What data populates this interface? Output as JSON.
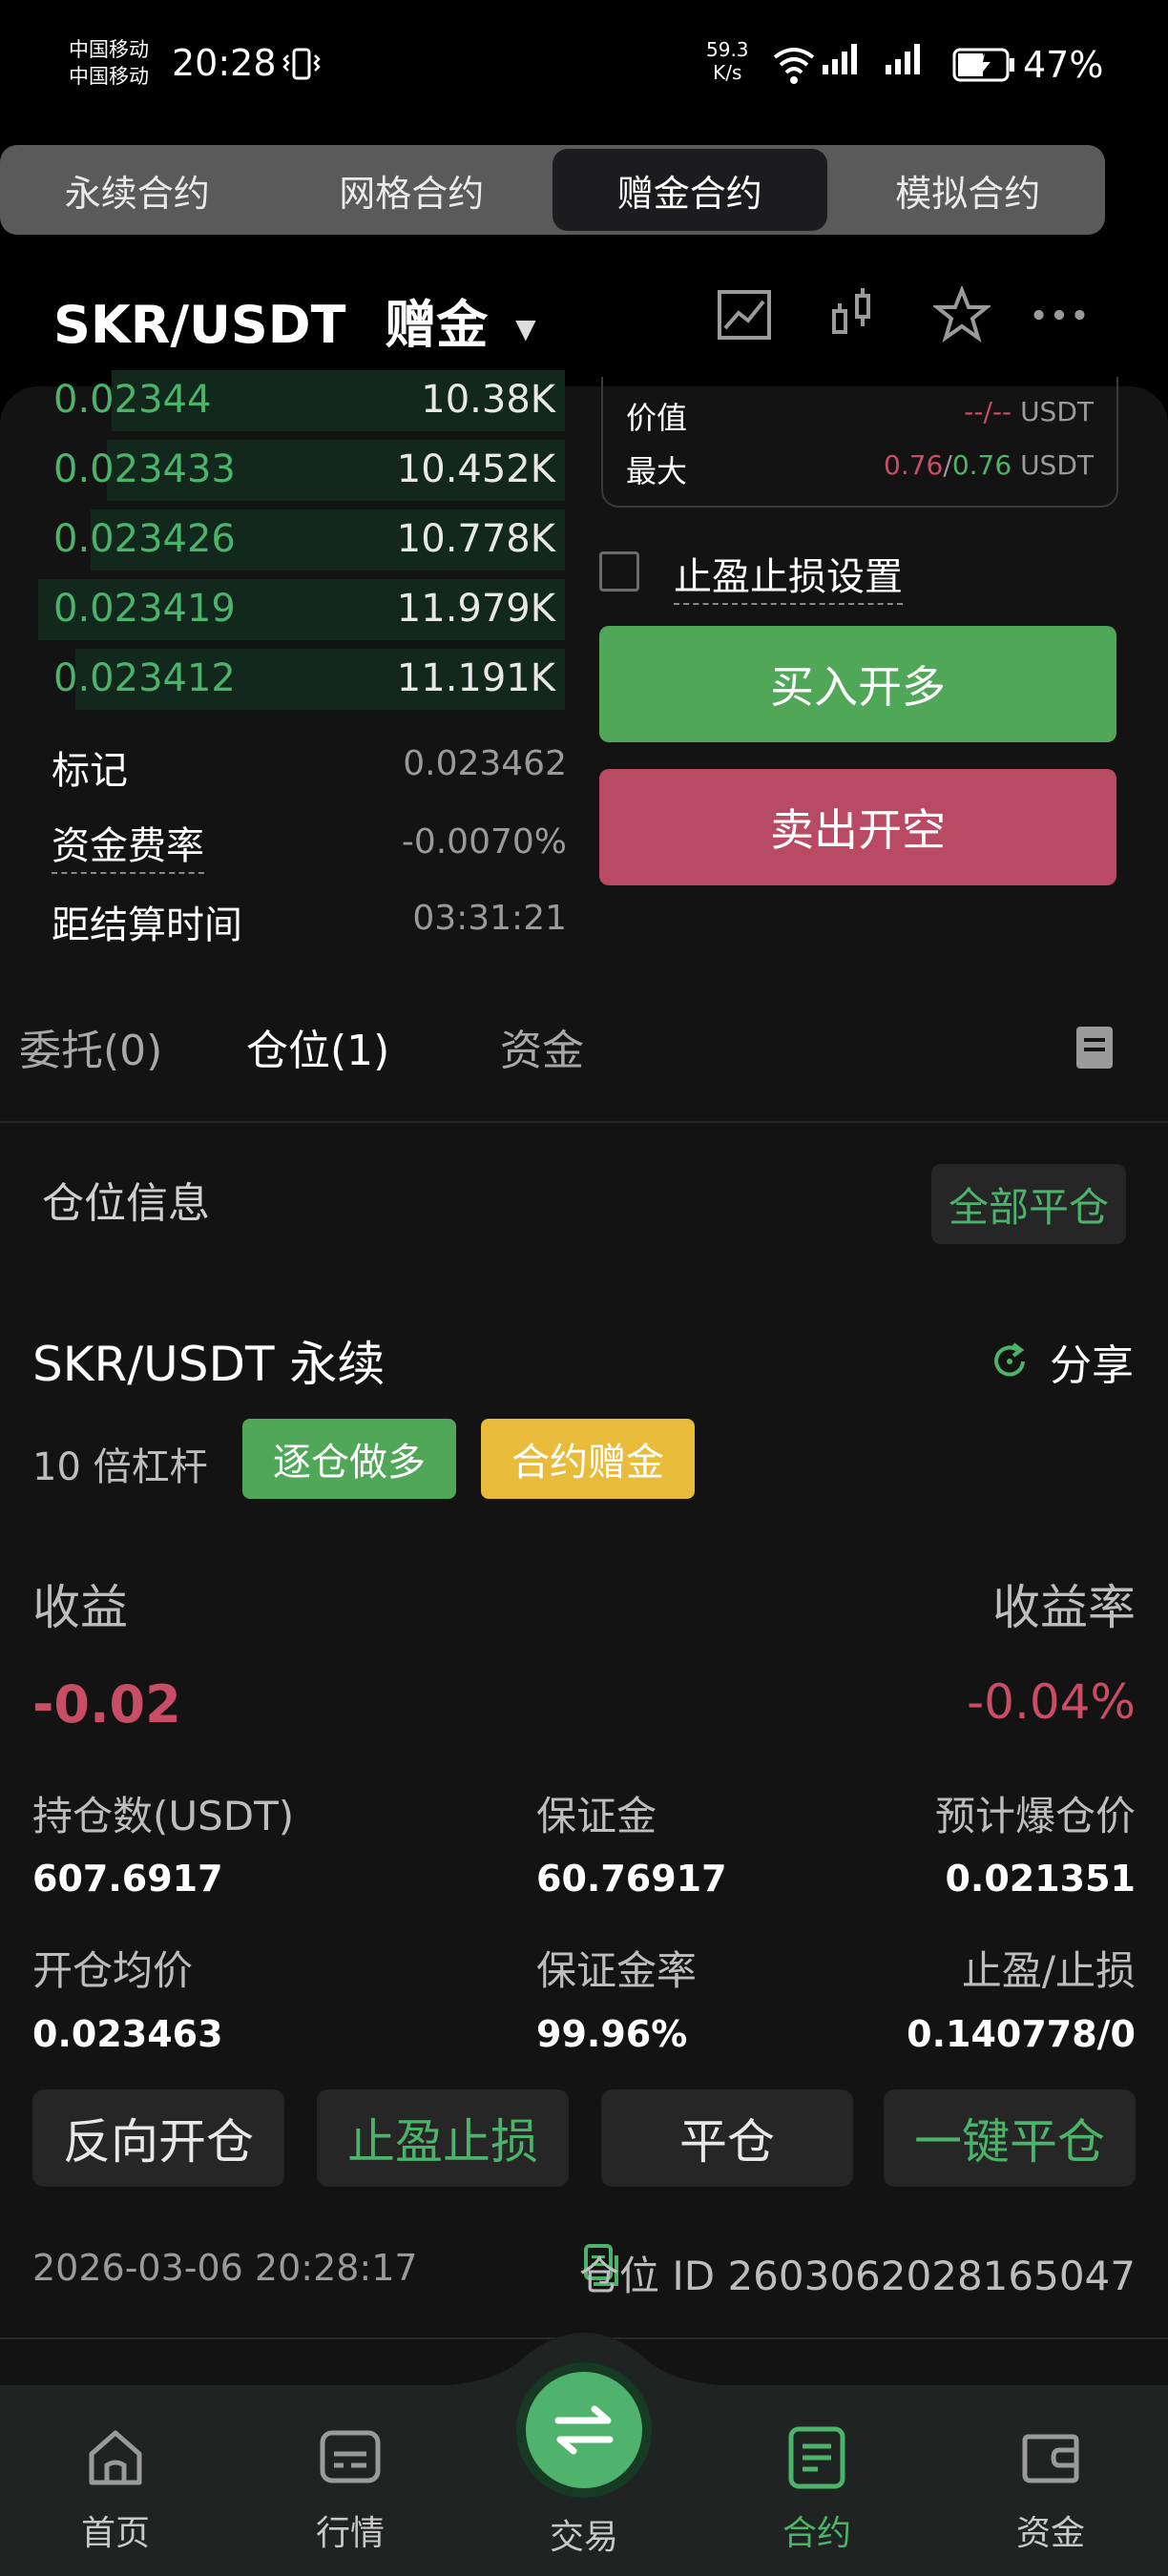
{
  "status_bar": {
    "carrier1": "中国移动",
    "carrier2": "中国移动",
    "time": "20:28",
    "speed_value": "59.3",
    "speed_unit": "K/s",
    "battery": "47%"
  },
  "top_tabs": [
    {
      "label": "永续合约",
      "active": false
    },
    {
      "label": "网格合约",
      "active": false
    },
    {
      "label": "赠金合约",
      "active": true
    },
    {
      "label": "模拟合约",
      "active": false
    }
  ],
  "header": {
    "pair": "SKR/USDT",
    "mode": "赠金"
  },
  "order_book": [
    {
      "price": "0.02344",
      "qty": "10.38K",
      "depth": 0.86
    },
    {
      "price": "0.023433",
      "qty": "10.452K",
      "depth": 0.87
    },
    {
      "price": "0.023426",
      "qty": "10.778K",
      "depth": 0.9
    },
    {
      "price": "0.023419",
      "qty": "11.979K",
      "depth": 1.0
    },
    {
      "price": "0.023412",
      "qty": "11.191K",
      "depth": 0.93
    }
  ],
  "market_info": {
    "mark_label": "标记",
    "mark_value": "0.023462",
    "funding_label": "资金费率",
    "funding_value": "-0.0070%",
    "settle_label": "距结算时间",
    "settle_value": "03:31:21"
  },
  "order_form": {
    "value_label": "价值",
    "value_dash": "--/--",
    "value_unit": "USDT",
    "max_label": "最大",
    "max_a": "0.76",
    "max_sep": "/",
    "max_b": "0.76",
    "max_unit": "USDT",
    "tpsl_label": "止盈止损设置",
    "buy_label": "买入开多",
    "sell_label": "卖出开空"
  },
  "sub_tabs": {
    "orders": "委托(0)",
    "positions": "仓位(1)",
    "funds": "资金"
  },
  "positions": {
    "title": "仓位信息",
    "close_all": "全部平仓",
    "symbol": "SKR/USDT 永续",
    "share": "分享",
    "leverage": "10 倍杠杆",
    "tag_side": "逐仓做多",
    "tag_bonus": "合约赠金",
    "pnl_label": "收益",
    "pnl_value": "-0.02",
    "roe_label": "收益率",
    "roe_value": "-0.04%",
    "size_label": "持仓数(USDT)",
    "size_value": "607.6917",
    "margin_label": "保证金",
    "margin_value": "60.76917",
    "liq_label": "预计爆仓价",
    "liq_value": "0.021351",
    "entry_label": "开仓均价",
    "entry_value": "0.023463",
    "margin_rate_label": "保证金率",
    "margin_rate_value": "99.96%",
    "tpsl_label": "止盈/止损",
    "tpsl_value": "0.140778/0",
    "btn_reverse": "反向开仓",
    "btn_tpsl": "止盈止损",
    "btn_close": "平仓",
    "btn_quick_close": "一键平仓",
    "timestamp": "2026-03-06 20:28:17",
    "position_id": "仓位 ID 2603062028165047"
  },
  "bottom_nav": [
    {
      "label": "首页",
      "icon": "home-icon",
      "active": false
    },
    {
      "label": "行情",
      "icon": "market-icon",
      "active": false
    },
    {
      "label": "交易",
      "icon": "swap-icon",
      "active": false
    },
    {
      "label": "合约",
      "icon": "contract-icon",
      "active": true
    },
    {
      "label": "资金",
      "icon": "wallet-icon",
      "active": false
    }
  ],
  "colors": {
    "green": "#4cb36b",
    "red": "#c94d64",
    "buy": "#4fa757",
    "sell": "#b84b63",
    "yellow": "#e8bb3a"
  }
}
